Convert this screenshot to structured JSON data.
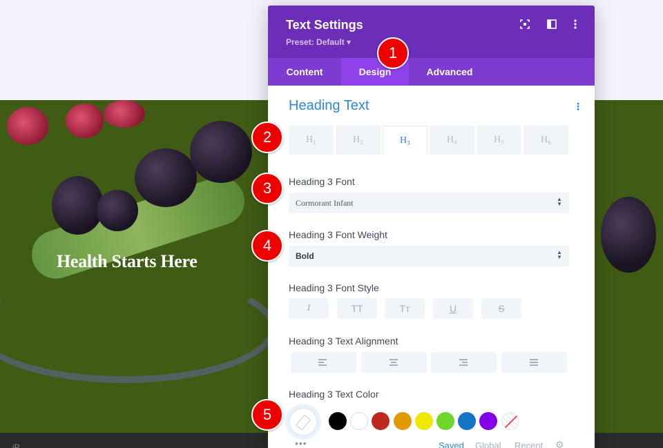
{
  "background": {
    "hero_title": "Health Starts Here",
    "footer_text": "iP..."
  },
  "modal": {
    "title": "Text Settings",
    "preset": "Preset: Default ▾",
    "header_icons": [
      "expand-icon",
      "split-view-icon",
      "more-vertical-icon"
    ],
    "tabs": [
      {
        "label": "Content",
        "active": false
      },
      {
        "label": "Design",
        "active": true
      },
      {
        "label": "Advanced",
        "active": false
      }
    ],
    "section_title": "Heading Text",
    "heading_tabs": [
      {
        "label": "H₁",
        "active": false
      },
      {
        "label": "H₂",
        "active": false
      },
      {
        "label": "H₃",
        "active": true
      },
      {
        "label": "H₄",
        "active": false
      },
      {
        "label": "H₅",
        "active": false
      },
      {
        "label": "H₆",
        "active": false
      }
    ],
    "font_label": "Heading 3 Font",
    "font_value": "Cormorant Infant",
    "weight_label": "Heading 3 Font Weight",
    "weight_value": "Bold",
    "style_label": "Heading 3 Font Style",
    "style_buttons": [
      "I",
      "TT",
      "Tт",
      "U",
      "S"
    ],
    "alignment_label": "Heading 3 Text Alignment",
    "alignment_options": [
      "left",
      "center",
      "right",
      "justify"
    ],
    "color_label": "Heading 3 Text Color",
    "color_swatches": [
      "#000000",
      "#ffffff",
      "#c0271d",
      "#e09900",
      "#f0e800",
      "#6ed52c",
      "#1475c7",
      "#8300e9",
      "none"
    ],
    "palette_tabs": {
      "saved": "Saved",
      "global": "Global",
      "recent": "Recent"
    },
    "accent_color": "#2b87da",
    "header_color": "#6c2eb9"
  },
  "markers": [
    "1",
    "2",
    "3",
    "4",
    "5"
  ]
}
